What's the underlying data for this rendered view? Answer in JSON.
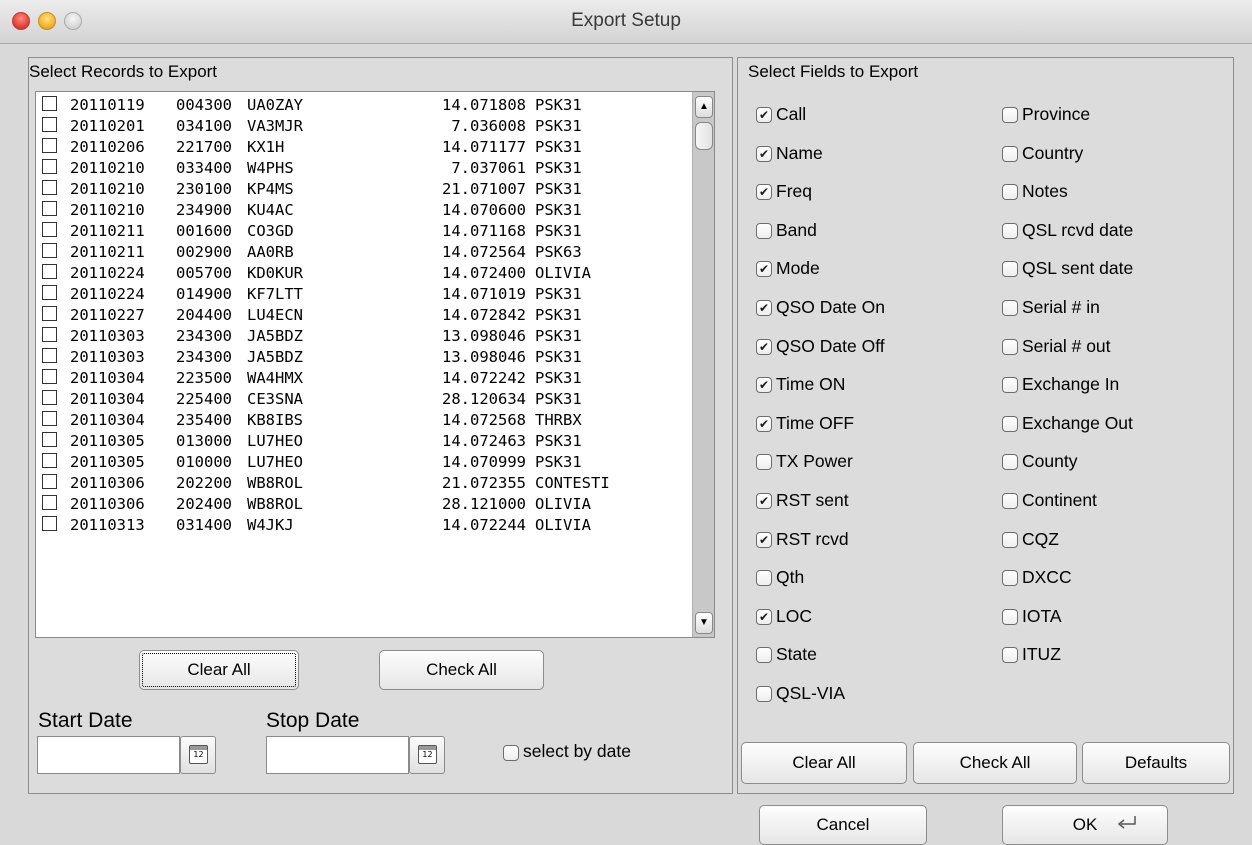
{
  "window": {
    "title": "Export Setup"
  },
  "records": {
    "title": "Select Records to Export",
    "rows": [
      {
        "date": "20110119",
        "time": "004300",
        "call": "UA0ZAY",
        "freq": "14.071808",
        "mode": "PSK31",
        "checked": false
      },
      {
        "date": "20110201",
        "time": "034100",
        "call": "VA3MJR",
        "freq": "7.036008",
        "mode": "PSK31",
        "checked": false
      },
      {
        "date": "20110206",
        "time": "221700",
        "call": "KX1H",
        "freq": "14.071177",
        "mode": "PSK31",
        "checked": false
      },
      {
        "date": "20110210",
        "time": "033400",
        "call": "W4PHS",
        "freq": "7.037061",
        "mode": "PSK31",
        "checked": false
      },
      {
        "date": "20110210",
        "time": "230100",
        "call": "KP4MS",
        "freq": "21.071007",
        "mode": "PSK31",
        "checked": false
      },
      {
        "date": "20110210",
        "time": "234900",
        "call": "KU4AC",
        "freq": "14.070600",
        "mode": "PSK31",
        "checked": false
      },
      {
        "date": "20110211",
        "time": "001600",
        "call": "CO3GD",
        "freq": "14.071168",
        "mode": "PSK31",
        "checked": false
      },
      {
        "date": "20110211",
        "time": "002900",
        "call": "AA0RB",
        "freq": "14.072564",
        "mode": "PSK63",
        "checked": false
      },
      {
        "date": "20110224",
        "time": "005700",
        "call": "KD0KUR",
        "freq": "14.072400",
        "mode": "OLIVIA",
        "checked": false
      },
      {
        "date": "20110224",
        "time": "014900",
        "call": "KF7LTT",
        "freq": "14.071019",
        "mode": "PSK31",
        "checked": false
      },
      {
        "date": "20110227",
        "time": "204400",
        "call": "LU4ECN",
        "freq": "14.072842",
        "mode": "PSK31",
        "checked": false
      },
      {
        "date": "20110303",
        "time": "234300",
        "call": "JA5BDZ",
        "freq": "13.098046",
        "mode": "PSK31",
        "checked": false
      },
      {
        "date": "20110303",
        "time": "234300",
        "call": "JA5BDZ",
        "freq": "13.098046",
        "mode": "PSK31",
        "checked": false
      },
      {
        "date": "20110304",
        "time": "223500",
        "call": "WA4HMX",
        "freq": "14.072242",
        "mode": "PSK31",
        "checked": false
      },
      {
        "date": "20110304",
        "time": "225400",
        "call": "CE3SNA",
        "freq": "28.120634",
        "mode": "PSK31",
        "checked": false
      },
      {
        "date": "20110304",
        "time": "235400",
        "call": "KB8IBS",
        "freq": "14.072568",
        "mode": "THRBX",
        "checked": false
      },
      {
        "date": "20110305",
        "time": "013000",
        "call": "LU7HEO",
        "freq": "14.072463",
        "mode": "PSK31",
        "checked": false
      },
      {
        "date": "20110305",
        "time": "010000",
        "call": "LU7HEO",
        "freq": "14.070999",
        "mode": "PSK31",
        "checked": false
      },
      {
        "date": "20110306",
        "time": "202200",
        "call": "WB8ROL",
        "freq": "21.072355",
        "mode": "CONTESTI",
        "checked": false
      },
      {
        "date": "20110306",
        "time": "202400",
        "call": "WB8ROL",
        "freq": "28.121000",
        "mode": "OLIVIA",
        "checked": false
      },
      {
        "date": "20110313",
        "time": "031400",
        "call": "W4JKJ",
        "freq": "14.072244",
        "mode": "OLIVIA",
        "checked": false
      }
    ],
    "clear_all_label": "Clear All",
    "check_all_label": "Check All",
    "start_date_label": "Start Date",
    "stop_date_label": "Stop Date",
    "start_date_value": "",
    "stop_date_value": "",
    "calendar_icon_text": "12",
    "select_by_date_label": "select by date",
    "select_by_date_checked": false
  },
  "fields": {
    "title": "Select Fields to Export",
    "left_column": [
      {
        "label": "Call",
        "checked": true
      },
      {
        "label": "Name",
        "checked": true
      },
      {
        "label": "Freq",
        "checked": true
      },
      {
        "label": "Band",
        "checked": false
      },
      {
        "label": "Mode",
        "checked": true
      },
      {
        "label": "QSO Date On",
        "checked": true
      },
      {
        "label": "QSO Date Off",
        "checked": true
      },
      {
        "label": "Time ON",
        "checked": true
      },
      {
        "label": "Time OFF",
        "checked": true
      },
      {
        "label": "TX Power",
        "checked": false
      },
      {
        "label": "RST sent",
        "checked": true
      },
      {
        "label": "RST rcvd",
        "checked": true
      },
      {
        "label": "Qth",
        "checked": false
      },
      {
        "label": "LOC",
        "checked": true
      },
      {
        "label": "State",
        "checked": false
      },
      {
        "label": "QSL-VIA",
        "checked": false
      }
    ],
    "right_column": [
      {
        "label": "Province",
        "checked": false
      },
      {
        "label": "Country",
        "checked": false
      },
      {
        "label": "Notes",
        "checked": false
      },
      {
        "label": "QSL rcvd date",
        "checked": false
      },
      {
        "label": "QSL sent date",
        "checked": false
      },
      {
        "label": "Serial # in",
        "checked": false
      },
      {
        "label": "Serial # out",
        "checked": false
      },
      {
        "label": "Exchange In",
        "checked": false
      },
      {
        "label": "Exchange Out",
        "checked": false
      },
      {
        "label": "County",
        "checked": false
      },
      {
        "label": "Continent",
        "checked": false
      },
      {
        "label": "CQZ",
        "checked": false
      },
      {
        "label": "DXCC",
        "checked": false
      },
      {
        "label": "IOTA",
        "checked": false
      },
      {
        "label": "ITUZ",
        "checked": false
      }
    ],
    "clear_all_label": "Clear All",
    "check_all_label": "Check All",
    "defaults_label": "Defaults"
  },
  "footer": {
    "cancel_label": "Cancel",
    "ok_label": "OK"
  },
  "icons": {
    "check_mark": "✔",
    "scroll_up": "▲",
    "scroll_down": "▼"
  }
}
